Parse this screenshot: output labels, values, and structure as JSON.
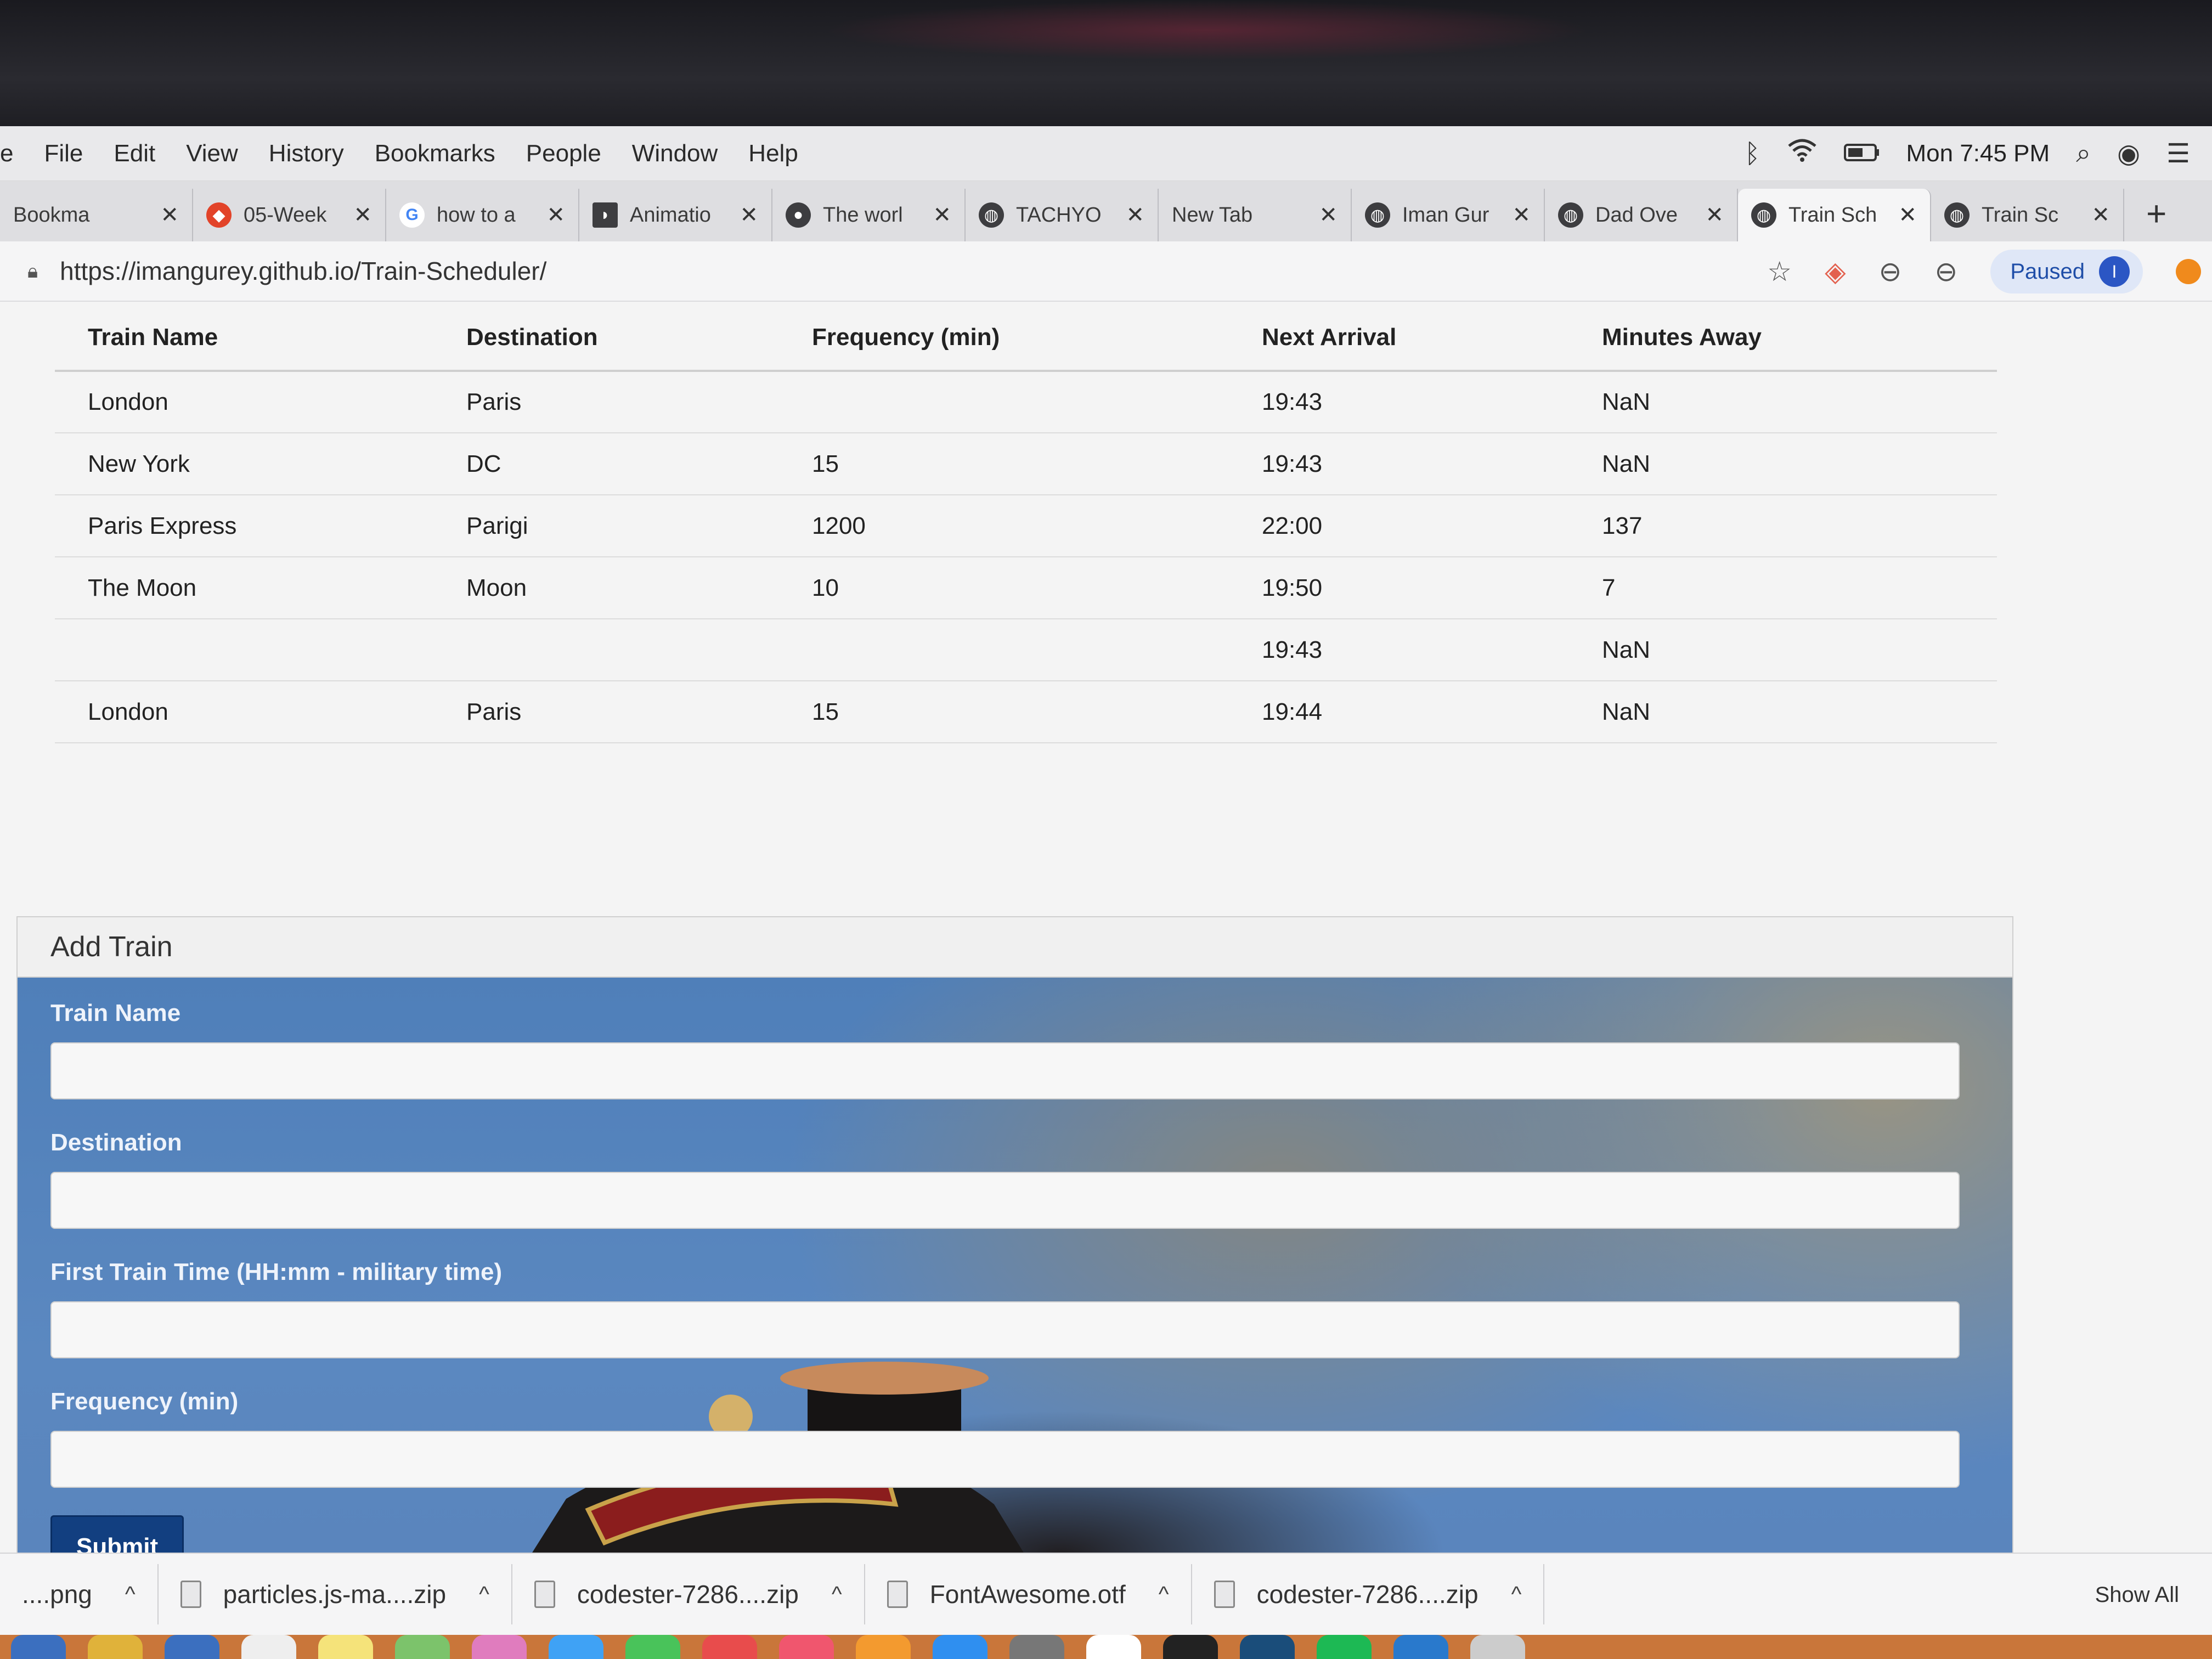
{
  "menubar": {
    "items": [
      "e",
      "File",
      "Edit",
      "View",
      "History",
      "Bookmarks",
      "People",
      "Window",
      "Help"
    ],
    "clock": "Mon 7:45 PM"
  },
  "tabs": [
    {
      "title": "Bookma",
      "icon": "bookmark-icon"
    },
    {
      "title": "05-Week",
      "icon": "gitlab-icon"
    },
    {
      "title": "how to a",
      "icon": "google-icon"
    },
    {
      "title": "Animatio",
      "icon": "patreon-icon"
    },
    {
      "title": "The worl",
      "icon": "github-icon"
    },
    {
      "title": "TACHYO",
      "icon": "globe-icon"
    },
    {
      "title": "New Tab",
      "icon": ""
    },
    {
      "title": "Iman Gur",
      "icon": "globe-icon"
    },
    {
      "title": "Dad Ove",
      "icon": "globe-icon"
    },
    {
      "title": "Train Sch",
      "icon": "globe-icon",
      "active": true
    },
    {
      "title": "Train Sc",
      "icon": "globe-icon"
    }
  ],
  "address": {
    "url": "https://imangurey.github.io/Train-Scheduler/",
    "paused_label": "Paused",
    "profile_initial": "I"
  },
  "table": {
    "headers": [
      "Train Name",
      "Destination",
      "Frequency (min)",
      "Next Arrival",
      "Minutes Away"
    ],
    "rows": [
      [
        "London",
        "Paris",
        "",
        "19:43",
        "NaN"
      ],
      [
        "New York",
        "DC",
        "15",
        "19:43",
        "NaN"
      ],
      [
        "Paris Express",
        "Parigi",
        "1200",
        "22:00",
        "137"
      ],
      [
        "The Moon",
        "Moon",
        "10",
        "19:50",
        "7"
      ],
      [
        "",
        "",
        "",
        "19:43",
        "NaN"
      ],
      [
        "London",
        "Paris",
        "15",
        "19:44",
        "NaN"
      ]
    ]
  },
  "form": {
    "heading": "Add Train",
    "fields": [
      {
        "label": "Train Name",
        "value": ""
      },
      {
        "label": "Destination",
        "value": ""
      },
      {
        "label": "First Train Time (HH:mm - military time)",
        "value": ""
      },
      {
        "label": "Frequency (min)",
        "value": ""
      }
    ],
    "submit_label": "Submit"
  },
  "downloads": {
    "items": [
      "....png",
      "particles.js-ma....zip",
      "codester-7286....zip",
      "FontAwesome.otf",
      "codester-7286....zip"
    ],
    "show_all_label": "Show All"
  },
  "colors": {
    "form_bg": "#5a86bd",
    "submit_bg": "#123f80",
    "paused_pill": "#dfe7f7"
  }
}
